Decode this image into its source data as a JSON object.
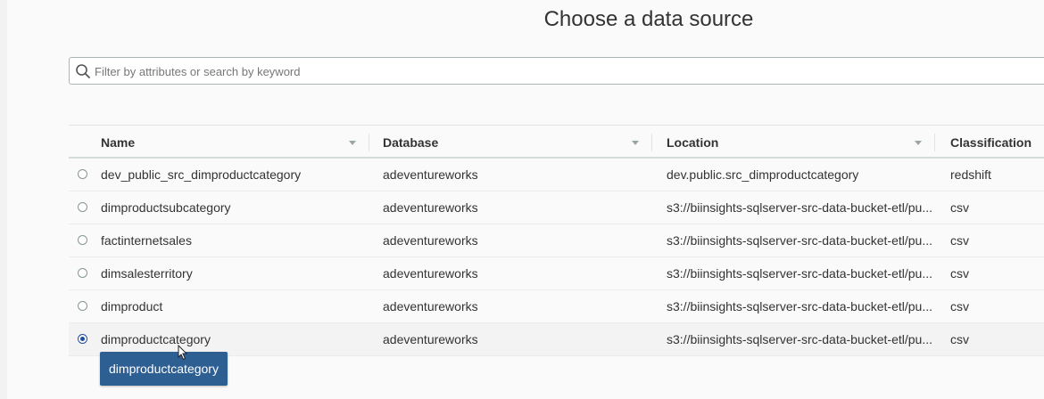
{
  "page": {
    "title": "Choose a data source"
  },
  "search": {
    "placeholder": "Filter by attributes or search by keyword",
    "value": ""
  },
  "table": {
    "columns": [
      {
        "label": "Name",
        "sortable": true
      },
      {
        "label": "Database",
        "sortable": true
      },
      {
        "label": "Location",
        "sortable": true
      },
      {
        "label": "Classification",
        "sortable": false
      }
    ],
    "rows": [
      {
        "name": "dev_public_src_dimproductcategory",
        "database": "adeventureworks",
        "location": "dev.public.src_dimproductcategory",
        "classification": "redshift",
        "selected": false
      },
      {
        "name": "dimproductsubcategory",
        "database": "adeventureworks",
        "location": "s3://biinsights-sqlserver-src-data-bucket-etl/pu...",
        "classification": "csv",
        "selected": false
      },
      {
        "name": "factinternetsales",
        "database": "adeventureworks",
        "location": "s3://biinsights-sqlserver-src-data-bucket-etl/pu...",
        "classification": "csv",
        "selected": false
      },
      {
        "name": "dimsalesterritory",
        "database": "adeventureworks",
        "location": "s3://biinsights-sqlserver-src-data-bucket-etl/pu...",
        "classification": "csv",
        "selected": false
      },
      {
        "name": "dimproduct",
        "database": "adeventureworks",
        "location": "s3://biinsights-sqlserver-src-data-bucket-etl/pu...",
        "classification": "csv",
        "selected": false
      },
      {
        "name": "dimproductcategory",
        "database": "adeventureworks",
        "location": "s3://biinsights-sqlserver-src-data-bucket-etl/pu...",
        "classification": "csv",
        "selected": true
      }
    ]
  },
  "tooltip": {
    "text": "dimproductcategory"
  },
  "colors": {
    "tooltip_bg": "#2e5f93",
    "radio_checked": "#1f4e9e",
    "border": "#aab7b8"
  },
  "icons": {
    "search": "search-icon",
    "sort": "caret-down-icon",
    "cursor": "mouse-pointer-icon"
  }
}
